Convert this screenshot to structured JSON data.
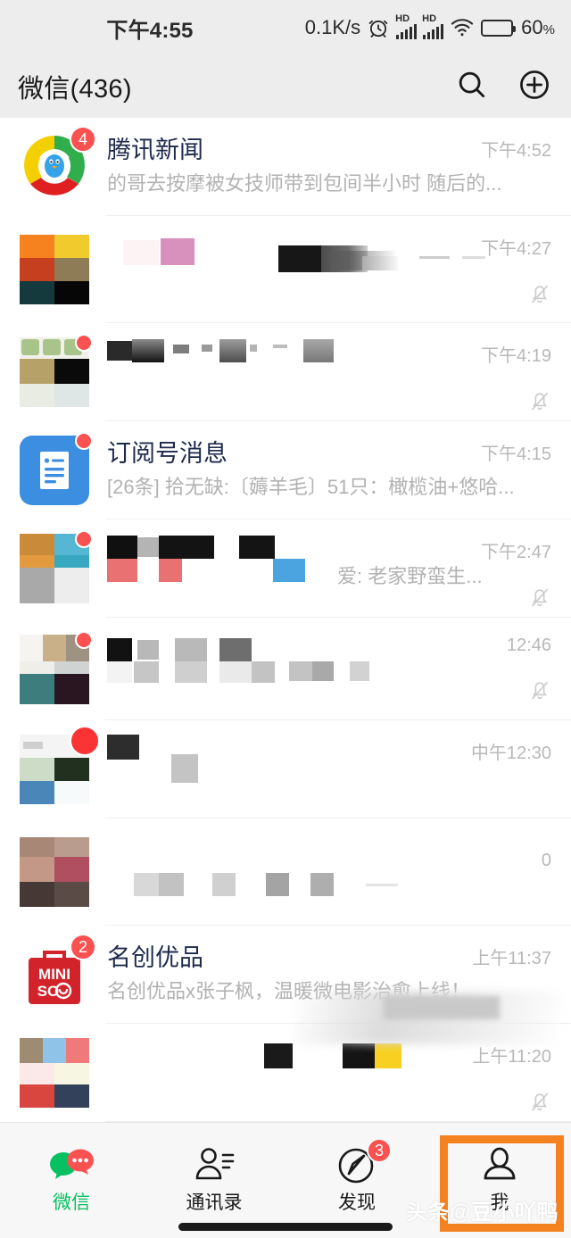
{
  "status_bar": {
    "time": "下午4:55",
    "net_speed": "0.1K/s",
    "battery_percent": "60",
    "battery_unit": "%",
    "battery_level": 60,
    "hd_label": "HD",
    "icons": [
      "alarm-icon",
      "hd-signal-icon",
      "hd-signal-icon",
      "wifi-icon",
      "battery-icon"
    ]
  },
  "header": {
    "title": "微信(436)",
    "unread_total": "436",
    "search_icon": "search-icon",
    "add_icon": "plus-circle-icon"
  },
  "colors": {
    "accent_green": "#07C160",
    "badge_red": "#FA5151",
    "highlight_orange": "#F58220",
    "header_bg": "#EDEDED",
    "list_bg": "#FFFFFF",
    "tabbar_bg": "#F7F7F7"
  },
  "chats": [
    {
      "title": "腾讯新闻",
      "preview": "的哥去按摩被女技师带到包间半小时 随后的...",
      "time": "下午4:52",
      "badge": "4",
      "muted": false,
      "censored": false,
      "avatar": "tencent-news-logo"
    },
    {
      "title": "",
      "preview": "",
      "time": "下午4:27",
      "badge": "",
      "muted": true,
      "censored": true,
      "avatar": "censored-avatar"
    },
    {
      "title": "",
      "preview": "",
      "time": "下午4:19",
      "badge": "dot",
      "muted": true,
      "censored": true,
      "avatar": "censored-avatar"
    },
    {
      "title": "订阅号消息",
      "preview": "[26条] 拾无缺:〔薅羊毛〕51只：橄榄油+悠哈...",
      "time": "下午4:15",
      "badge": "dot",
      "muted": false,
      "censored": false,
      "avatar": "subscription-account-icon"
    },
    {
      "title": "",
      "preview": "爱: 老家野蛮生...",
      "time": "下午2:47",
      "badge": "dot",
      "muted": true,
      "censored": true,
      "avatar": "censored-avatar"
    },
    {
      "title": "",
      "preview": "",
      "time": "12:46",
      "badge": "dot",
      "muted": true,
      "censored": true,
      "avatar": "censored-avatar"
    },
    {
      "title": "",
      "preview": "",
      "time": "中午12:30",
      "badge": "dot",
      "muted": false,
      "censored": true,
      "avatar": "censored-avatar"
    },
    {
      "title": "",
      "preview": "",
      "time": "0",
      "badge": "",
      "muted": false,
      "censored": true,
      "avatar": "censored-avatar"
    },
    {
      "title": "名创优品",
      "preview": "名创优品x张子枫，温暖微电影治愈上线！",
      "time": "上午11:37",
      "badge": "2",
      "muted": false,
      "censored": false,
      "avatar": "miniso-logo"
    },
    {
      "title": "",
      "preview": "",
      "time": "上午11:20",
      "badge": "",
      "muted": true,
      "censored": true,
      "avatar": "censored-avatar"
    }
  ],
  "avatars": {
    "miniso_line1": "MINI",
    "miniso_line2": "SO"
  },
  "tab_bar": {
    "items": [
      {
        "label": "微信",
        "icon": "chat-bubbles-icon",
        "active": true,
        "badge": ""
      },
      {
        "label": "通讯录",
        "icon": "contacts-icon",
        "active": false,
        "badge": ""
      },
      {
        "label": "发现",
        "icon": "compass-icon",
        "active": false,
        "badge": "3"
      },
      {
        "label": "我",
        "icon": "person-icon",
        "active": false,
        "badge": ""
      }
    ],
    "highlighted_item": "我"
  },
  "watermark": {
    "text": "头条@豆小吖鸭"
  }
}
